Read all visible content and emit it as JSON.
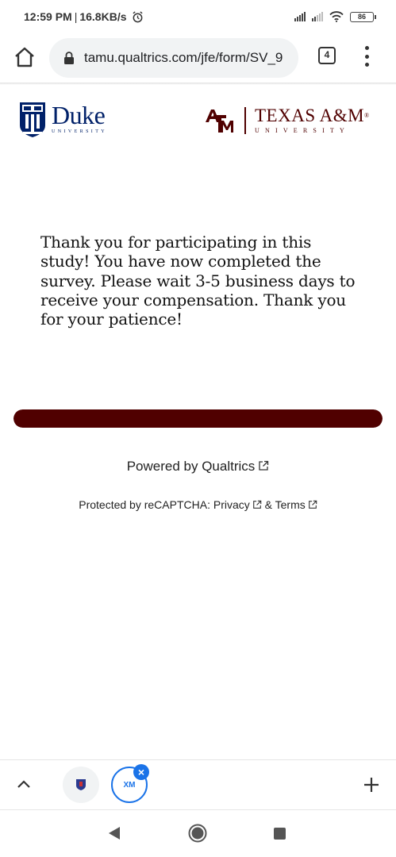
{
  "status_bar": {
    "time": "12:59 PM",
    "separator": "|",
    "net_speed": "16.8KB/s",
    "battery": "86"
  },
  "browser": {
    "url": "tamu.qualtrics.com/jfe/form/SV_9",
    "tab_count": "4"
  },
  "logos": {
    "duke_name": "Duke",
    "duke_sub": "UNIVERSITY",
    "tamu_name": "TEXAS A&M",
    "tamu_sub": "UNIVERSITY",
    "tamu_reg": "®"
  },
  "message": "Thank you for participating in this study! You have now completed the survey. Please wait 3-5 business days to receive your compensation. Thank you for your patience!",
  "progress": {
    "fraction": 1.0,
    "color": "#500000"
  },
  "footer": {
    "powered_by": "Powered by Qualtrics",
    "recaptcha_prefix": "Protected by reCAPTCHA: ",
    "privacy": "Privacy",
    "amp": " & ",
    "terms": "Terms"
  },
  "tab_switcher": {
    "tab2_label": "XM",
    "close_symbol": "×"
  },
  "colors": {
    "duke_blue": "#012169",
    "tamu_maroon": "#500000",
    "accent_blue": "#1a73e8"
  }
}
